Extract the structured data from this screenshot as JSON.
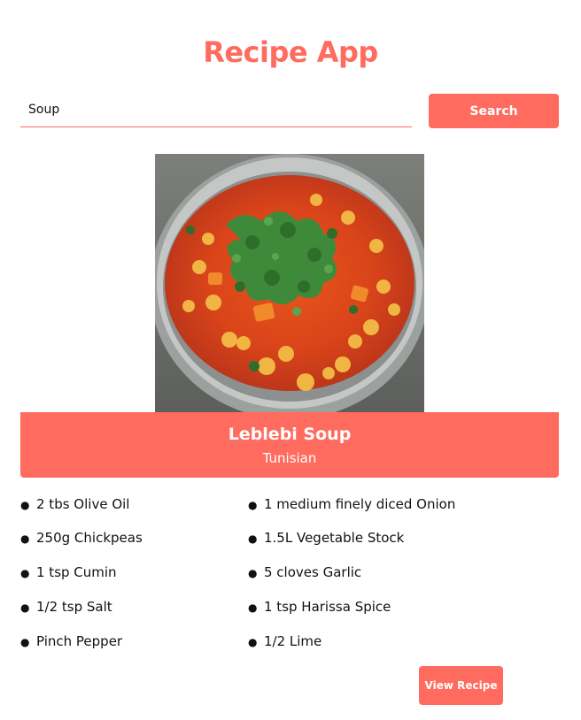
{
  "app": {
    "title": "Recipe App"
  },
  "search": {
    "value": "Soup",
    "button_label": "Search"
  },
  "recipe": {
    "name": "Leblebi Soup",
    "area": "Tunisian",
    "ingredients": [
      "2 tbs Olive Oil",
      "1 medium finely diced Onion",
      "250g Chickpeas",
      "1.5L Vegetable Stock",
      "1 tsp Cumin",
      "5 cloves Garlic",
      "1/2 tsp Salt",
      "1 tsp Harissa Spice",
      "Pinch Pepper",
      "1/2 Lime"
    ],
    "view_button_label": "View Recipe"
  },
  "colors": {
    "accent": "#ff6b5e"
  }
}
